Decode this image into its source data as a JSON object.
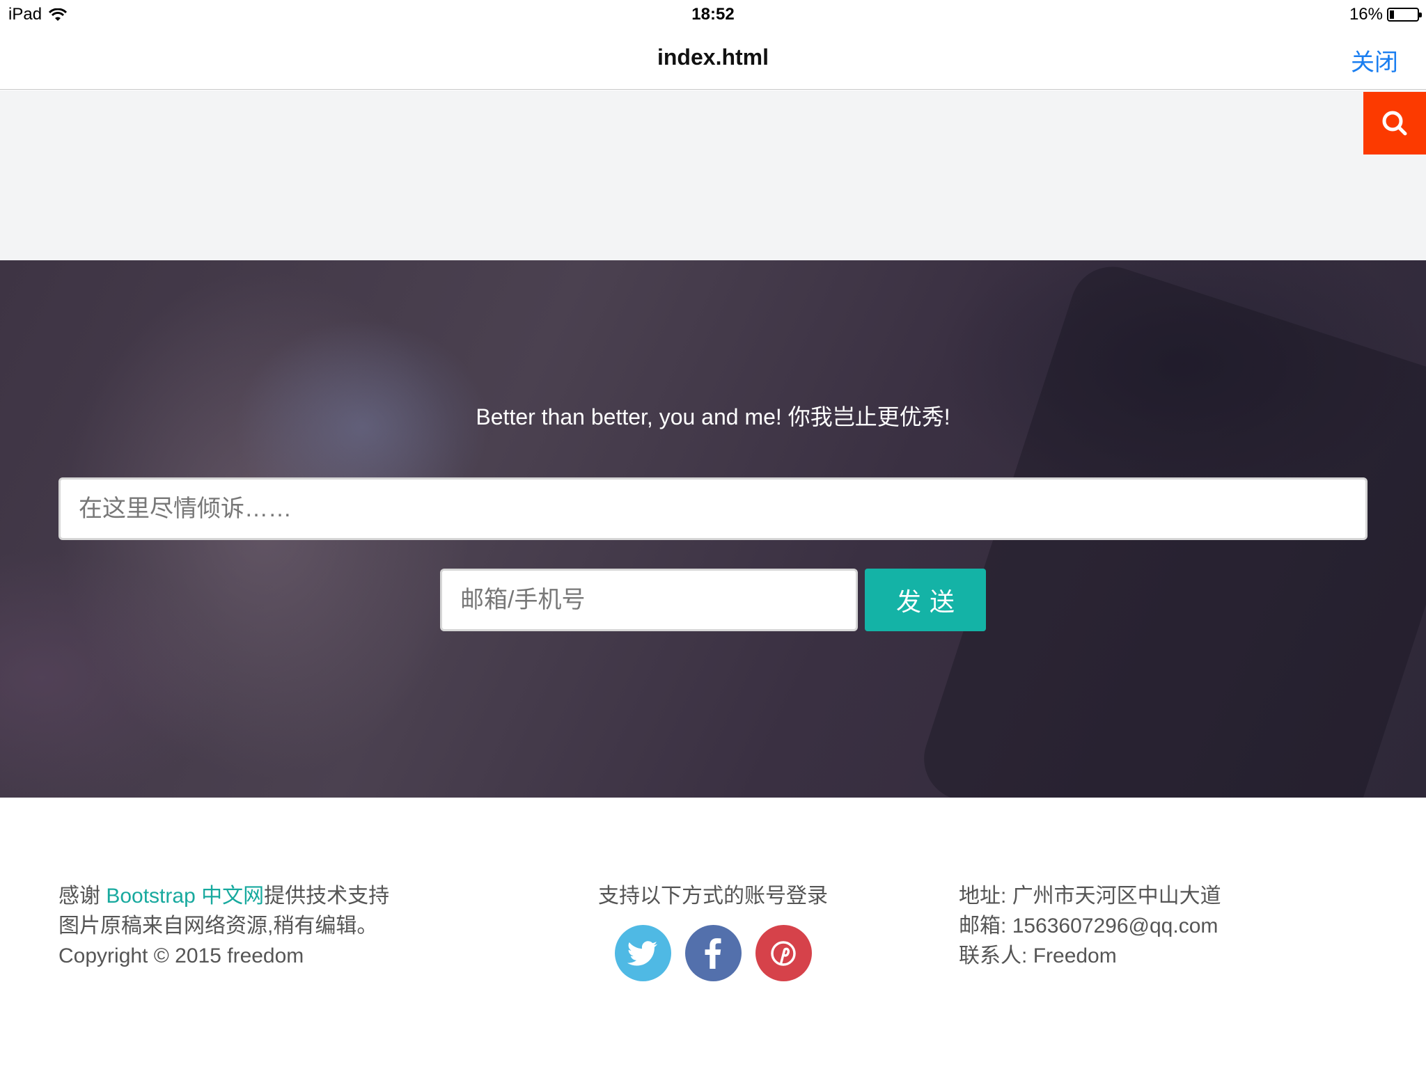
{
  "status_bar": {
    "device": "iPad",
    "time": "18:52",
    "battery_percent": "16%",
    "battery_level": 0.16
  },
  "nav": {
    "title": "index.html",
    "close_label": "关闭"
  },
  "colors": {
    "search_button": "#fc3a00",
    "send_button": "#14b3a6",
    "link": "#17a99e",
    "close_link": "#1a7ef0"
  },
  "search": {
    "icon": "search-icon"
  },
  "hero": {
    "slogan": "Better than better, you and me! 你我岂止更优秀!",
    "message_placeholder": "在这里尽情倾诉……",
    "contact_placeholder": "邮箱/手机号",
    "send_label": "发送"
  },
  "footer": {
    "left": {
      "thanks_prefix": "感谢 ",
      "thanks_link": "Bootstrap 中文网",
      "thanks_suffix": "提供技术支持",
      "image_note": "图片原稿来自网络资源,稍有编辑。",
      "copyright": "Copyright © 2015 freedom"
    },
    "middle": {
      "login_title": "支持以下方式的账号登录",
      "social": [
        "twitter-icon",
        "facebook-icon",
        "pinterest-icon"
      ]
    },
    "right": {
      "address_label": "地址:",
      "address": "广州市天河区中山大道",
      "email_label": "邮箱:",
      "email": "1563607296@qq.com",
      "contact_label": "联系人:",
      "contact": "Freedom"
    }
  }
}
